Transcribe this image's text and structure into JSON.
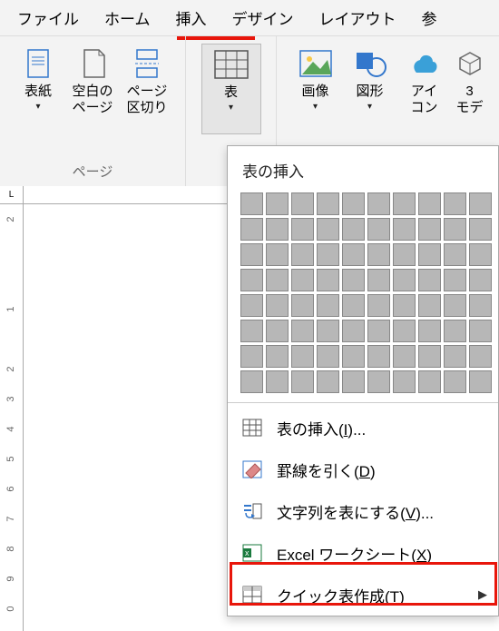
{
  "menubar": {
    "tabs": [
      "ファイル",
      "ホーム",
      "挿入",
      "デザイン",
      "レイアウト",
      "参"
    ]
  },
  "ribbon": {
    "pages_group_label": "ページ",
    "cover": "表紙",
    "blank": "空白の\nページ",
    "break": "ページ\n区切り",
    "table": "表",
    "picture": "画像",
    "shapes": "図形",
    "icons": "アイ\nコン",
    "models": "3\nモデ"
  },
  "dropdown": {
    "title": "表の挿入",
    "insert_table": "表の挿入(",
    "insert_table_key": "I",
    "insert_table_suffix": ")...",
    "draw_table": "罫線を引く(",
    "draw_table_key": "D",
    "draw_table_suffix": ")",
    "text_to_table": "文字列を表にする(",
    "text_to_table_key": "V",
    "text_to_table_suffix": ")...",
    "excel": "Excel ワークシート(",
    "excel_key": "X",
    "excel_suffix": ")",
    "quick": "クイック表作成(",
    "quick_key": "T",
    "quick_suffix": ")"
  },
  "ruler_label": "L",
  "ruler_left": [
    "2",
    "",
    "",
    "1",
    "",
    "2",
    "3",
    "4",
    "5",
    "6",
    "7",
    "8",
    "9",
    "0"
  ]
}
